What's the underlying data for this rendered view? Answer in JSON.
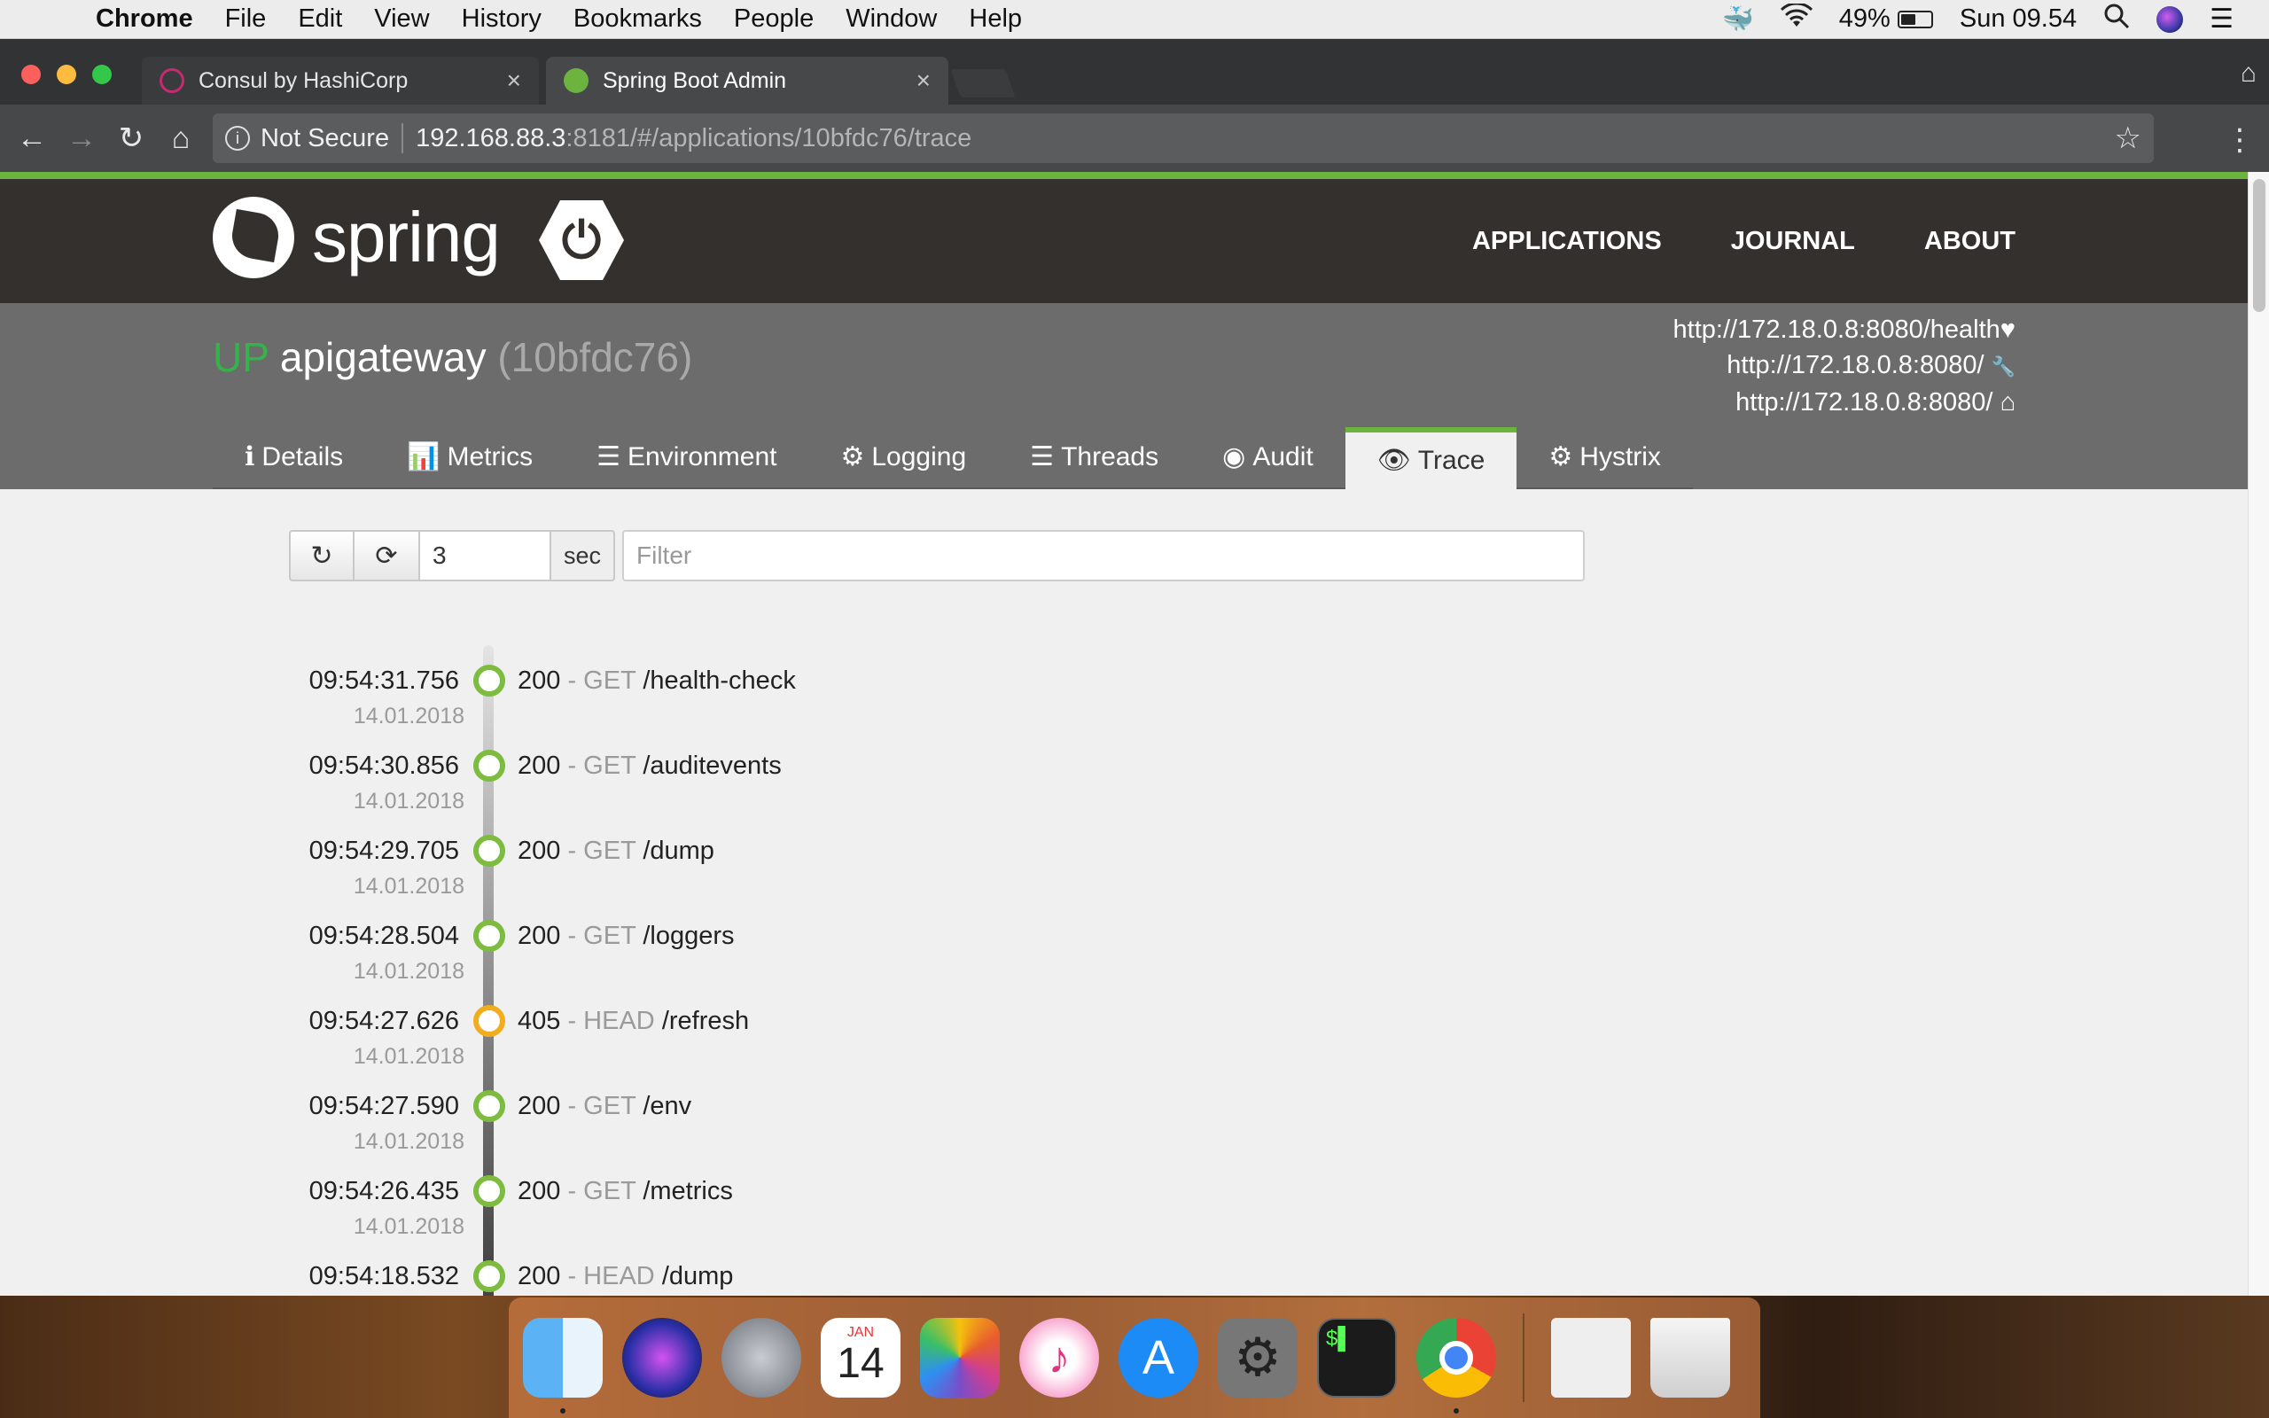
{
  "menubar": {
    "apple": "",
    "app_name": "Chrome",
    "items": [
      "File",
      "Edit",
      "View",
      "History",
      "Bookmarks",
      "People",
      "Window",
      "Help"
    ],
    "battery_percent": "49%",
    "battery_level": 0.49,
    "clock": "Sun 09.54"
  },
  "browser": {
    "tabs": [
      {
        "title": "Consul by HashiCorp",
        "close": "×"
      },
      {
        "title": "Spring Boot Admin",
        "close": "×"
      }
    ],
    "security_label": "Not Secure",
    "url_host": "192.168.88.3",
    "url_rest": ":8181/#/applications/10bfdc76/trace"
  },
  "header": {
    "logo_text": "spring",
    "nav": [
      "APPLICATIONS",
      "JOURNAL",
      "ABOUT"
    ]
  },
  "app": {
    "status": "UP",
    "name": "apigateway",
    "id": "(10bfdc76)",
    "urls": [
      {
        "text": "http://172.18.0.8:8080/health",
        "icon": "♥"
      },
      {
        "text": "http://172.18.0.8:8080/",
        "icon": "🔧"
      },
      {
        "text": "http://172.18.0.8:8080/",
        "icon": "⌂"
      }
    ],
    "tabs": [
      {
        "icon": "ℹ",
        "label": "Details"
      },
      {
        "icon": "📊",
        "label": "Metrics"
      },
      {
        "icon": "☰",
        "label": "Environment"
      },
      {
        "icon": "⚙",
        "label": "Logging"
      },
      {
        "icon": "☰",
        "label": "Threads"
      },
      {
        "icon": "◉",
        "label": "Audit"
      },
      {
        "icon": "👁",
        "label": "Trace"
      },
      {
        "icon": "⚙",
        "label": "Hystrix"
      }
    ],
    "active_tab": "Trace"
  },
  "controls": {
    "interval_value": "3",
    "interval_unit": "sec",
    "filter_placeholder": "Filter"
  },
  "traces": [
    {
      "time": "09:54:31.756",
      "date": "14.01.2018",
      "status": "200",
      "method": "GET",
      "path": "/health-check",
      "level": "ok"
    },
    {
      "time": "09:54:30.856",
      "date": "14.01.2018",
      "status": "200",
      "method": "GET",
      "path": "/auditevents",
      "level": "ok"
    },
    {
      "time": "09:54:29.705",
      "date": "14.01.2018",
      "status": "200",
      "method": "GET",
      "path": "/dump",
      "level": "ok"
    },
    {
      "time": "09:54:28.504",
      "date": "14.01.2018",
      "status": "200",
      "method": "GET",
      "path": "/loggers",
      "level": "ok"
    },
    {
      "time": "09:54:27.626",
      "date": "14.01.2018",
      "status": "405",
      "method": "HEAD",
      "path": "/refresh",
      "level": "warn"
    },
    {
      "time": "09:54:27.590",
      "date": "14.01.2018",
      "status": "200",
      "method": "GET",
      "path": "/env",
      "level": "ok"
    },
    {
      "time": "09:54:26.435",
      "date": "14.01.2018",
      "status": "200",
      "method": "GET",
      "path": "/metrics",
      "level": "ok"
    },
    {
      "time": "09:54:18.532",
      "date": "",
      "status": "200",
      "method": "HEAD",
      "path": "/dump",
      "level": "ok"
    }
  ],
  "dock": {
    "calendar_month": "JAN",
    "calendar_day": "14",
    "apps": [
      "finder-icon",
      "siri-icon",
      "launchpad-icon",
      "calendar-icon",
      "photos-icon",
      "itunes-icon",
      "app-store-icon",
      "system-preferences-icon",
      "terminal-icon",
      "chrome-icon",
      "preview-icon",
      "trash-icon"
    ]
  },
  "colors": {
    "spring_green": "#6db33f",
    "status_up": "#34b34a",
    "trace_ok": "#7cbc3e",
    "trace_warn": "#f0ad1e"
  }
}
